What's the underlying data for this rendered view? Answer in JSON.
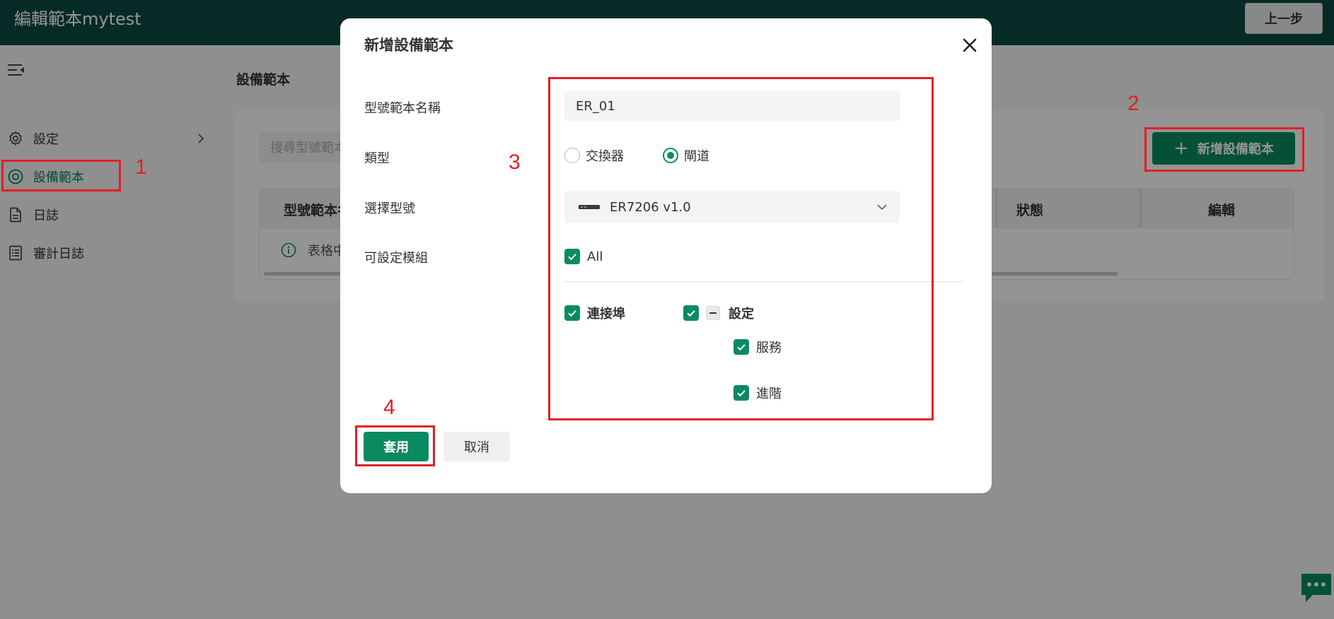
{
  "header": {
    "title": "編輯範本mytest",
    "back_label": "上一步"
  },
  "sidebar": {
    "items": [
      {
        "label": "設定",
        "icon": "gear-icon"
      },
      {
        "label": "設備範本",
        "icon": "target-icon"
      },
      {
        "label": "日誌",
        "icon": "document-icon"
      },
      {
        "label": "審計日誌",
        "icon": "list-document-icon"
      }
    ]
  },
  "main": {
    "section_title": "設備範本",
    "search_placeholder": "搜尋型號範本",
    "add_button_label": "新增設備範本",
    "table": {
      "columns": [
        "型號範本名稱",
        "狀態",
        "編輯"
      ],
      "empty_text": "表格中"
    }
  },
  "modal": {
    "title": "新增設備範本",
    "fields": {
      "name_label": "型號範本名稱",
      "name_value": "ER_01",
      "type_label": "類型",
      "type_options": [
        "交換器",
        "閘道"
      ],
      "type_selected": "閘道",
      "model_label": "選擇型號",
      "model_value": "ER7206 v1.0",
      "modules_label": "可設定模組"
    },
    "modules": {
      "all": "All",
      "ports": "連接埠",
      "settings": "設定",
      "service": "服務",
      "advanced": "進階"
    },
    "apply_label": "套用",
    "cancel_label": "取消"
  },
  "annotations": [
    "1",
    "2",
    "3",
    "4"
  ],
  "colors": {
    "topbar": "#0b4a43",
    "primary": "#0a8a61",
    "annotation": "#e21f26"
  }
}
